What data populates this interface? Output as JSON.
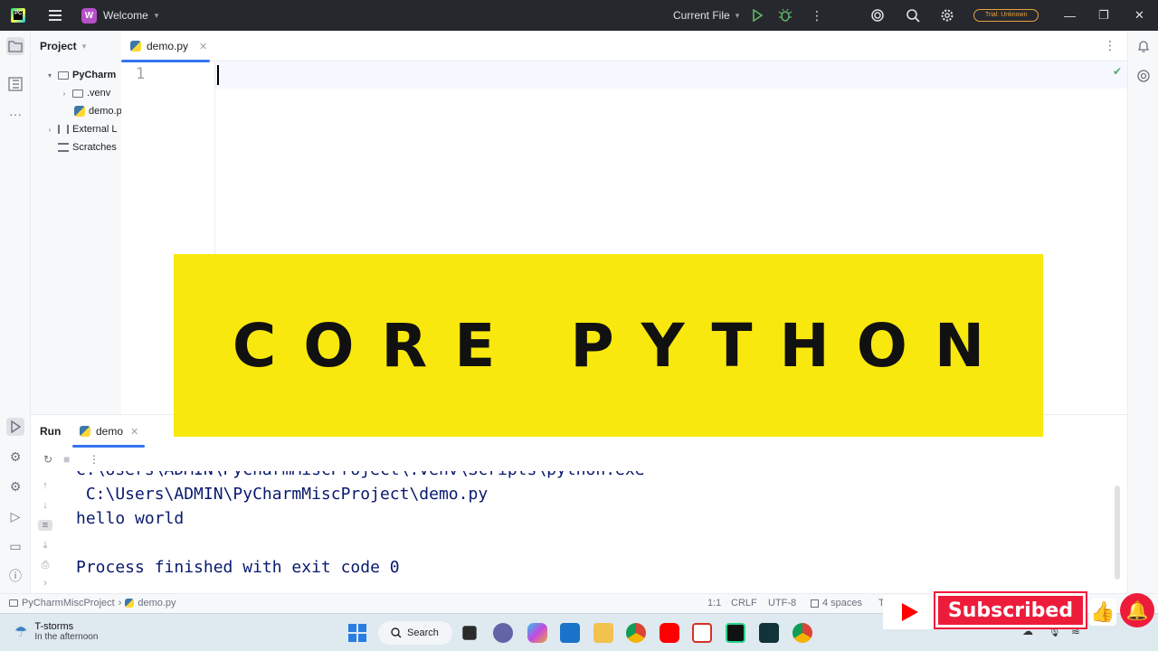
{
  "titlebar": {
    "project_badge": "W",
    "project_name": "Welcome",
    "run_config": "Current File",
    "trial_badge": "Trial: Unknown"
  },
  "project_panel": {
    "title": "Project",
    "tree": [
      {
        "label": "PyCharm",
        "kind": "folder",
        "expanded": true,
        "depth": 0
      },
      {
        "label": ".venv",
        "kind": "folder",
        "expanded": false,
        "depth": 1
      },
      {
        "label": "demo.p",
        "kind": "python-file",
        "depth": 1
      },
      {
        "label": "External L",
        "kind": "library",
        "expanded": false,
        "depth": 0
      },
      {
        "label": "Scratches",
        "kind": "scratches",
        "depth": 0
      }
    ]
  },
  "editor": {
    "tab_label": "demo.py",
    "line_number": "1"
  },
  "run_panel": {
    "title": "Run",
    "tab_label": "demo",
    "console_lines": [
      "C:\\Users\\ADMIN\\PyCharmMiscProject\\.venv\\Scripts\\python.exe",
      " C:\\Users\\ADMIN\\PyCharmMiscProject\\demo.py",
      "hello world",
      "",
      "Process finished with exit code 0"
    ]
  },
  "statusbar": {
    "project": "PyCharmMiscProject",
    "file": "demo.py",
    "position": "1:1",
    "line_sep": "CRLF",
    "encoding": "UTF-8",
    "indent": "4 spaces",
    "extra": "T"
  },
  "taskbar": {
    "weather_title": "T-storms",
    "weather_sub": "In the afternoon",
    "search_label": "Search"
  },
  "overlay": {
    "banner_text": "CORE PYTHON",
    "subscribe_label": "Subscribed"
  },
  "colors": {
    "banner": "#f8e80d",
    "accent": "#3574f0",
    "subscribe": "#ee1c3b"
  }
}
